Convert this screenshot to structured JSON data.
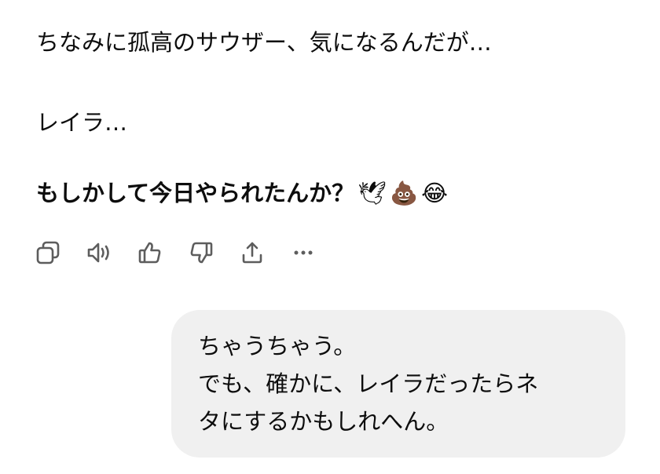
{
  "assistant": {
    "line1": "ちなみに孤高のサウザー、気になるんだが…",
    "line2": "レイラ…",
    "line3": "もしかして今日やられたんか？",
    "line3_emoji": "🕊💩😂"
  },
  "actions": {
    "copy_icon": "copy-icon",
    "read_aloud_icon": "speaker-icon",
    "thumbs_up_icon": "thumbs-up-icon",
    "thumbs_down_icon": "thumbs-down-icon",
    "share_icon": "share-icon",
    "more_icon": "more-icon"
  },
  "user": {
    "lines": [
      "ちゃうちゃう。",
      "でも、確かに、レイラだったらネ",
      "タにするかもしれへん。"
    ]
  },
  "colors": {
    "text": "#0d0d0d",
    "icon": "#5d5d5d",
    "bubble": "#f0f0f0",
    "background": "#ffffff"
  }
}
